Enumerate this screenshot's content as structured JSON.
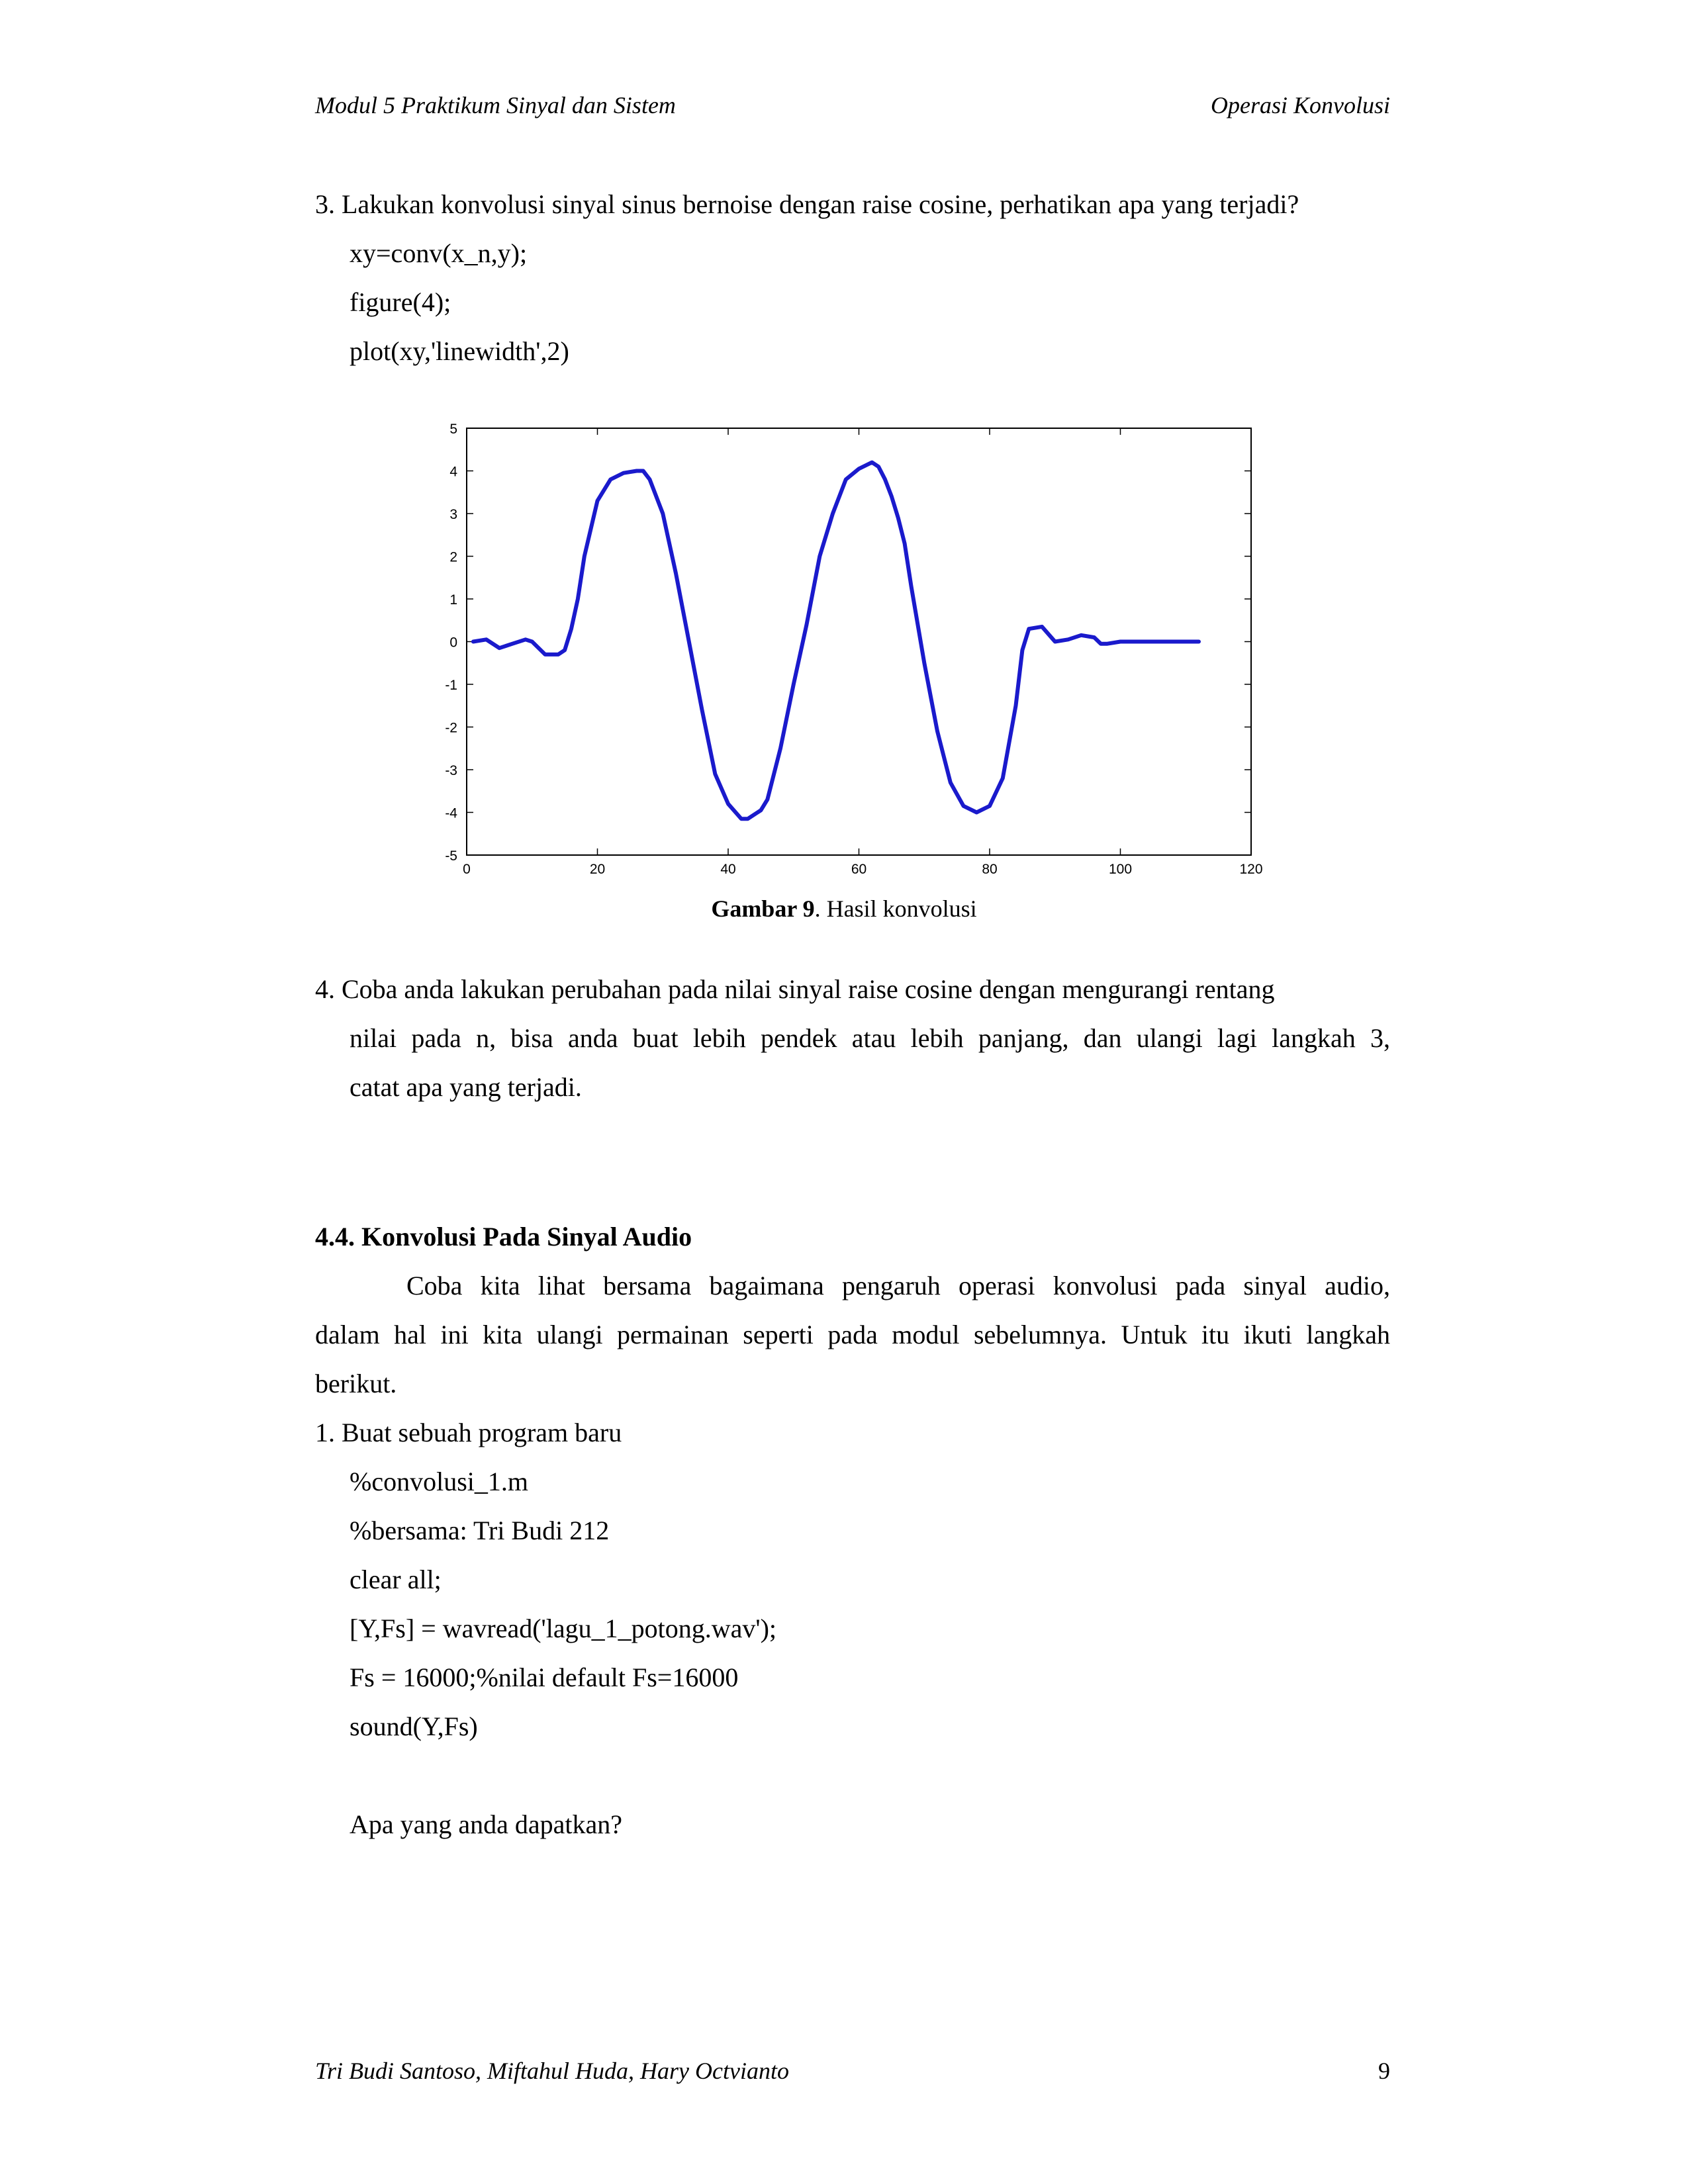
{
  "header": {
    "left": "Modul 5 Praktikum Sinyal dan Sistem",
    "right": "Operasi Konvolusi"
  },
  "step3": {
    "text": "3. Lakukan konvolusi sinyal sinus bernoise dengan raise cosine,  perhatikan apa yang terjadi?",
    "code": [
      "xy=conv(x_n,y);",
      "figure(4);",
      "plot(xy,'linewidth',2)"
    ]
  },
  "figure": {
    "caption_bold": "Gambar 9",
    "caption_rest": ". Hasil konvolusi"
  },
  "chart_data": {
    "type": "line",
    "title": "",
    "xlabel": "",
    "ylabel": "",
    "xlim": [
      0,
      120
    ],
    "ylim": [
      -5,
      5
    ],
    "x_ticks": [
      0,
      20,
      40,
      60,
      80,
      100,
      120
    ],
    "y_ticks": [
      5,
      4,
      3,
      2,
      1,
      0,
      -1,
      -2,
      -3,
      -4,
      -5
    ],
    "line_color": "#1a1acc",
    "grid": false,
    "series": [
      {
        "x": [
          1,
          3,
          5,
          7,
          9,
          10,
          12,
          14,
          15,
          16,
          17,
          18,
          20,
          22,
          24,
          26,
          27,
          28,
          30,
          32,
          34,
          36,
          38,
          40,
          42,
          43,
          44,
          45,
          46,
          48,
          50,
          52,
          54,
          56,
          58,
          60,
          62,
          63,
          64,
          65,
          66,
          67,
          68,
          70,
          72,
          74,
          76,
          78,
          80,
          82,
          84,
          85,
          86,
          88,
          90,
          92,
          94,
          96,
          97,
          98,
          100,
          102,
          104,
          106,
          108,
          110,
          112
        ],
        "y": [
          0.0,
          0.05,
          -0.15,
          -0.05,
          0.05,
          0.0,
          -0.3,
          -0.3,
          -0.2,
          0.3,
          1.0,
          2.0,
          3.3,
          3.8,
          3.95,
          4.0,
          4.0,
          3.8,
          3.0,
          1.6,
          0.0,
          -1.6,
          -3.1,
          -3.8,
          -4.15,
          -4.15,
          -4.05,
          -3.95,
          -3.7,
          -2.5,
          -1.0,
          0.4,
          2.0,
          3.0,
          3.8,
          4.05,
          4.2,
          4.1,
          3.8,
          3.4,
          2.9,
          2.3,
          1.3,
          -0.5,
          -2.1,
          -3.3,
          -3.85,
          -4.0,
          -3.85,
          -3.2,
          -1.5,
          -0.2,
          0.3,
          0.35,
          0.0,
          0.05,
          0.15,
          0.1,
          -0.05,
          -0.05,
          0.0,
          0.0,
          0.0,
          0.0,
          0.0,
          0.0,
          0.0
        ]
      }
    ]
  },
  "step4": {
    "line1": "4. Coba anda lakukan perubahan pada nilai sinyal raise cosine dengan   mengurangi rentang",
    "line2": "nilai pada n, bisa anda buat lebih pendek atau lebih panjang, dan ulangi lagi langkah 3,",
    "line3": "catat apa yang terjadi."
  },
  "section": {
    "heading": "4.4. Konvolusi Pada Sinyal Audio",
    "para_line1": "Coba kita lihat bersama bagaimana pengaruh operasi konvolusi pada sinyal audio,",
    "para_line2": "dalam hal ini kita ulangi permainan seperti pada modul sebelumnya. Untuk itu ikuti langkah",
    "para_line3": "berikut.",
    "step1": "1. Buat sebuah program baru",
    "code": [
      "%convolusi_1.m",
      "%bersama: Tri Budi 212",
      "clear all;",
      "[Y,Fs] = wavread('lagu_1_potong.wav');",
      "Fs = 16000;%nilai default Fs=16000",
      "sound(Y,Fs)"
    ],
    "question": "Apa yang anda dapatkan?"
  },
  "footer": {
    "authors": "Tri Budi Santoso, Miftahul Huda, Hary Octvianto",
    "page": "9"
  }
}
